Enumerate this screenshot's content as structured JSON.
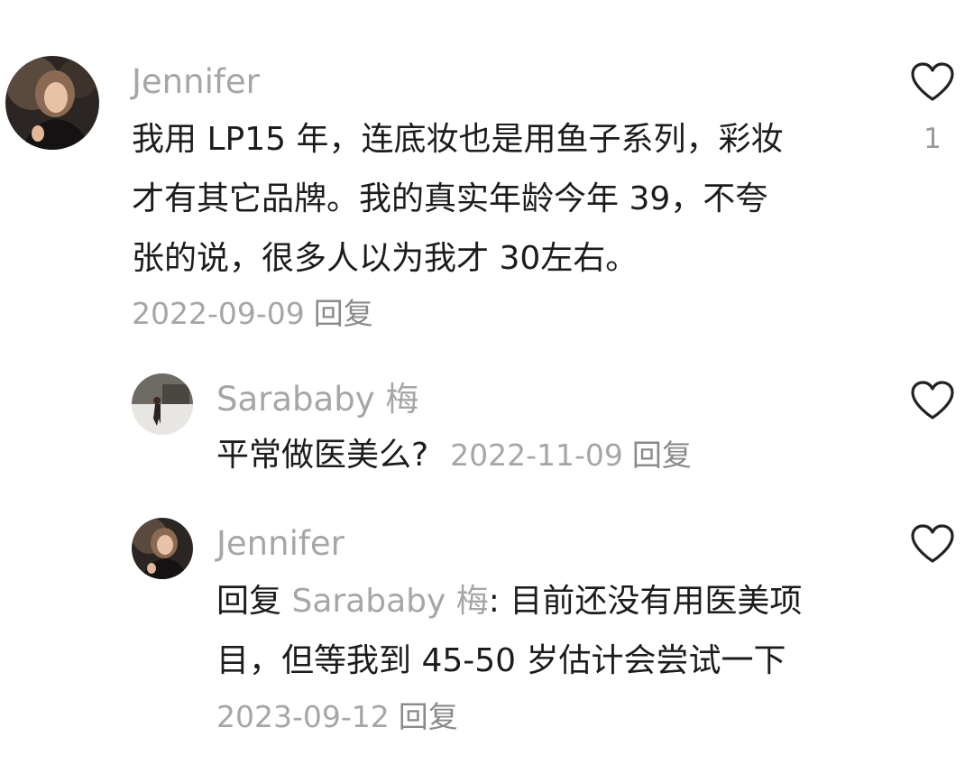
{
  "comments": [
    {
      "username": "Jennifer",
      "lines": [
        "我用 LP15 年，连底妆也是用鱼子系列，彩妆",
        "才有其它品牌。我的真实年龄今年 39，不夸",
        "张的说，很多人以为我才 30左右。"
      ],
      "date": "2022-09-09",
      "reply_label": "回复",
      "likes": "1"
    }
  ],
  "replies": [
    {
      "username": "Sarababy 梅",
      "text": "平常做医美么?",
      "date": "2022-11-09",
      "reply_label": "回复"
    },
    {
      "username": "Jennifer",
      "reply_prefix": "回复",
      "mention": "Sarababy 梅",
      "line1_rest": ": 目前还没有用医美项",
      "line2": "目，但等我到 45-50 岁估计会尝试一下",
      "date": "2023-09-12",
      "reply_label": "回复"
    }
  ],
  "icons": {
    "like": "heart-outline-icon"
  }
}
